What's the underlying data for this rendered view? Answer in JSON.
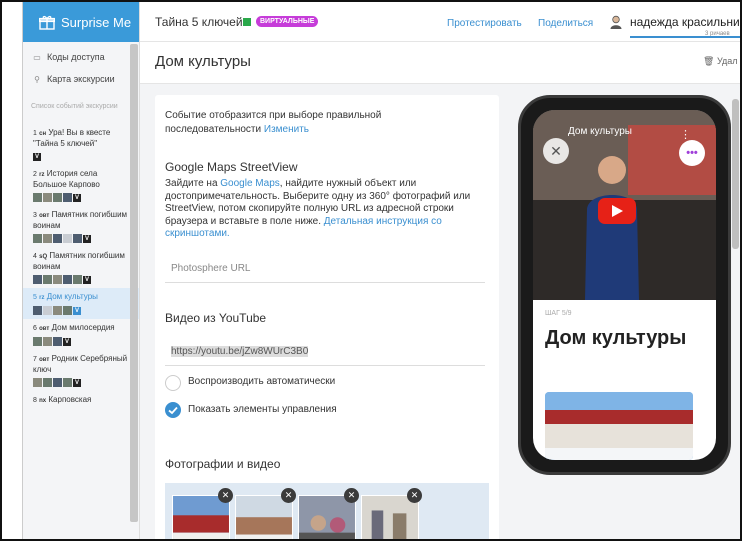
{
  "brand": {
    "name": "Surprise Me"
  },
  "sidebar": {
    "links": [
      {
        "label": "Коды доступа",
        "icon": "keycode-icon"
      },
      {
        "label": "Карта экскурсии",
        "icon": "map-pin-icon"
      }
    ],
    "events_heading": "Список событий экскурсии",
    "events": [
      {
        "num": "1",
        "tag": "сн",
        "title": "Ура! Вы в квесте \"Тайна 5 ключей\""
      },
      {
        "num": "2",
        "tag": "rz",
        "title": "История села Большое Карпово"
      },
      {
        "num": "3",
        "tag": "oвт",
        "title": "Памятник погибшим воинам"
      },
      {
        "num": "4",
        "tag": "sQ",
        "title": "Памятник погибшим воинам"
      },
      {
        "num": "5",
        "tag": "rz",
        "title": "Дом культуры"
      },
      {
        "num": "6",
        "tag": "oвт",
        "title": "Дом милосердия"
      },
      {
        "num": "7",
        "tag": "oвт",
        "title": "Родник Серебряный ключ"
      },
      {
        "num": "8",
        "tag": "nx",
        "title": "Карповская"
      }
    ]
  },
  "topbar": {
    "quest": "Тайна 5 ключей",
    "badge": "ВИРТУАЛЬНЫЕ",
    "test": "Протестировать",
    "share": "Поделиться",
    "user": "надежда красильник",
    "user_sub": "3 ричаев"
  },
  "page": {
    "title": "Дом культуры",
    "delete": "Удал"
  },
  "form": {
    "trigger_text": "Событие отобразится при выборе правильной последовательности",
    "trigger_link": "Изменить",
    "gm_heading": "Google Maps StreetView",
    "gm_text_1": "Зайдите на",
    "gm_link_1": "Google Maps",
    "gm_text_2": ", найдите нужный объект или достопримечательность. Выберите одну из 360° фотографий или StreetView, потом скопируйте полную URL из адресной строки браузера и вставьте в поле ниже.",
    "gm_link_2": "Детальная инструкция со скриншотами.",
    "photosphere_placeholder": "Photosphere URL",
    "yt_heading": "Видео из YouTube",
    "yt_value": "https://youtu.be/jZw8WUrC3B0",
    "autoplay_label": "Воспроизводить автоматически",
    "autoplay": false,
    "controls_label": "Показать элементы управления",
    "controls": true,
    "media_heading": "Фотографии и видео"
  },
  "phone": {
    "video_title": "Дом культуры",
    "step": "ШАГ 5/9",
    "title": "Дом культуры"
  },
  "colors": {
    "accent": "#3a8fd0",
    "brand": "#3a9ad9",
    "badge": "#c63cd9",
    "play": "#e62117"
  }
}
